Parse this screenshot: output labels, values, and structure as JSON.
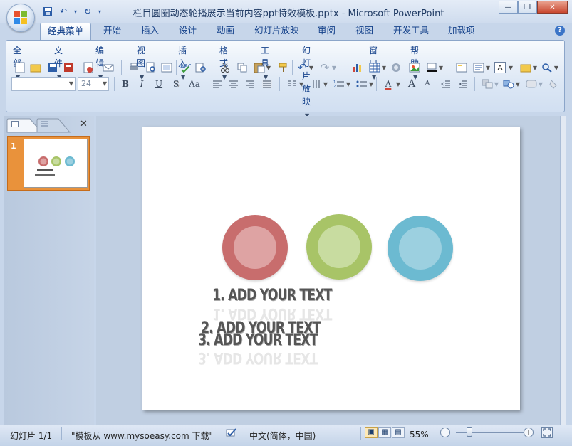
{
  "window": {
    "title": "栏目圆圈动态轮播展示当前内容ppt特效模板.pptx - Microsoft PowerPoint",
    "minimize_glyph": "—",
    "restore_glyph": "❐",
    "close_glyph": "✕"
  },
  "quick_access": {
    "save_icon": "save-icon",
    "undo_glyph": "↶",
    "redo_glyph": "↻",
    "dropdown_glyph": "▾"
  },
  "ribbon_tabs": [
    "经典菜单",
    "开始",
    "插入",
    "设计",
    "动画",
    "幻灯片放映",
    "审阅",
    "视图",
    "开发工具",
    "加载项"
  ],
  "help_glyph": "?",
  "classic_menu": [
    "全部",
    "文件",
    "编辑",
    "视图",
    "插入",
    "格式",
    "工具",
    "幻灯片放映",
    "窗口",
    "帮助"
  ],
  "formatting": {
    "font_name": "",
    "font_size": "24",
    "bold": "B",
    "italic": "I",
    "underline": "U",
    "shadow": "S",
    "change_case": "Aa",
    "font_color": "A",
    "grow_font": "A",
    "shrink_font": "A"
  },
  "panel": {
    "close_glyph": "✕",
    "slide_number": "1"
  },
  "slide": {
    "circles": [
      {
        "outer": "#c86d6d",
        "inner": "#dea3a3"
      },
      {
        "outer": "#a8c467",
        "inner": "#c8dca0"
      },
      {
        "outer": "#6cbad1",
        "inner": "#9cd0e0"
      }
    ],
    "items": [
      "1. ADD YOUR TEXT",
      "2. ADD YOUR TEXT",
      "3. ADD YOUR TEXT"
    ]
  },
  "statusbar": {
    "slide_info": "幻灯片 1/1",
    "theme": "\"模板从 www.mysoeasy.com 下载\"",
    "language": "中文(简体，中国)",
    "zoom": "55%",
    "zoom_out": "−",
    "zoom_in": "+"
  },
  "colors": {
    "accent": "#15428b",
    "thumb_selected": "#e9923b"
  }
}
